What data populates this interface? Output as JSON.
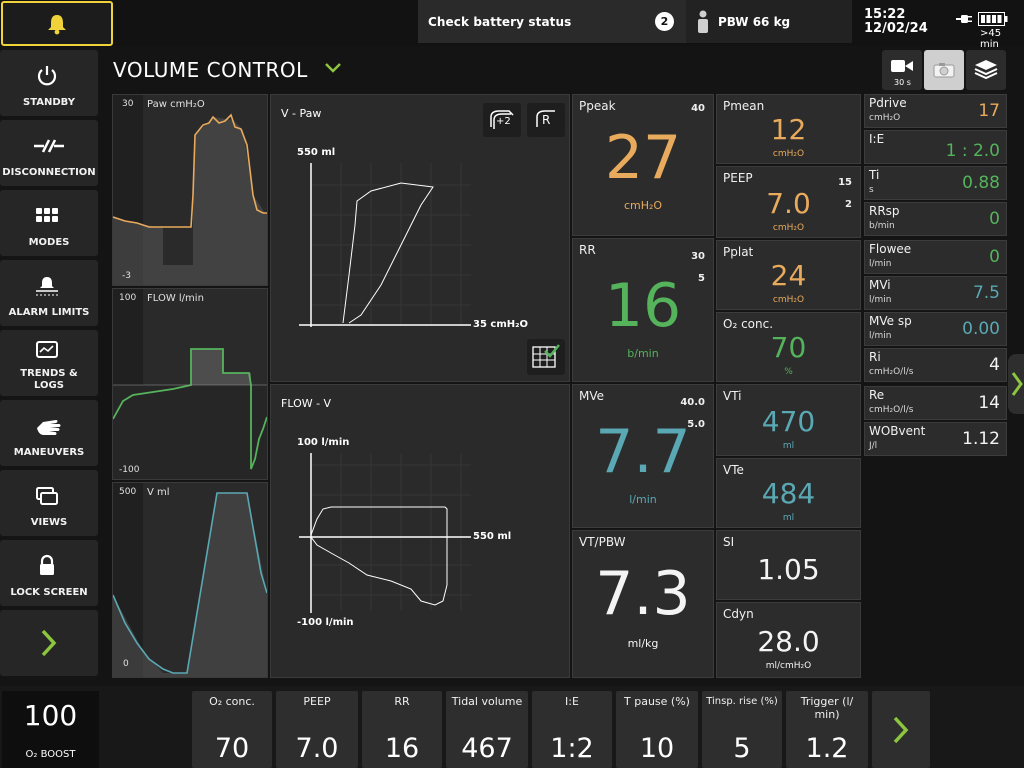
{
  "colors": {
    "alarm": "#f0d23a",
    "orange": "#e8aa5c",
    "green": "#55b35c",
    "teal": "#5aa8b4",
    "accent_green": "#8cc63f"
  },
  "topbar": {
    "alarm_message": "Check battery status",
    "alarm_count": "2",
    "pbw": "PBW 66 kg",
    "time": "15:22",
    "date": "12/02/24",
    "battery_remaining": ">45 min"
  },
  "nav": {
    "standby": "STANDBY",
    "disconnection": "DISCONNECTION",
    "modes": "MODES",
    "alarm_limits": "ALARM LIMITS",
    "trends_logs": "TRENDS & LOGS",
    "maneuvers": "MANEUVERS",
    "views": "VIEWS",
    "lock_screen": "LOCK SCREEN"
  },
  "mode": {
    "title": "VOLUME CONTROL"
  },
  "toolbar": {
    "record_label": "30 s"
  },
  "waves": {
    "paw": {
      "label": "Paw cmH₂O",
      "max": "30",
      "min": "-3"
    },
    "flow": {
      "label": "FLOW l/min",
      "max": "100",
      "min": "-100"
    },
    "vol": {
      "label": "V ml",
      "max": "500",
      "min": "0"
    }
  },
  "loops": {
    "vpaw": {
      "title": "V - Paw",
      "y_label": "550 ml",
      "x_label": "35 cmH₂O",
      "btn1": "+2",
      "btn2": "R"
    },
    "flowv": {
      "title": "FLOW - V",
      "y_top": "100 l/min",
      "y_bottom": "-100 l/min",
      "x_label": "550 ml"
    }
  },
  "tiles": {
    "ppeak": {
      "name": "Ppeak",
      "limit_hi": "40",
      "value": "27",
      "unit": "cmH₂O"
    },
    "rr": {
      "name": "RR",
      "limit_hi": "30",
      "limit_lo": "5",
      "value": "16",
      "unit": "b/min"
    },
    "mve": {
      "name": "MVe",
      "limit_hi": "40.0",
      "limit_lo": "5.0",
      "value": "7.7",
      "unit": "l/min"
    },
    "vtpbw": {
      "name": "VT/PBW",
      "value": "7.3",
      "unit": "ml/kg"
    },
    "pmean": {
      "name": "Pmean",
      "value": "12",
      "unit": "cmH₂O"
    },
    "peep": {
      "name": "PEEP",
      "limit_hi": "15",
      "limit_lo": "2",
      "value": "7.0",
      "unit": "cmH₂O"
    },
    "pplat": {
      "name": "Pplat",
      "value": "24",
      "unit": "cmH₂O"
    },
    "o2": {
      "name": "O₂ conc.",
      "value": "70",
      "unit": "%"
    },
    "vti": {
      "name": "VTi",
      "value": "470",
      "unit": "ml"
    },
    "vte": {
      "name": "VTe",
      "value": "484",
      "unit": "ml"
    },
    "si": {
      "name": "SI",
      "value": "1.05"
    },
    "cdyn": {
      "name": "Cdyn",
      "value": "28.0",
      "unit": "ml/cmH₂O"
    }
  },
  "small": [
    {
      "name": "Pdrive",
      "sub": "cmH₂O",
      "value": "17"
    },
    {
      "name": "I:E",
      "sub": "",
      "value": "1 : 2.0"
    },
    {
      "name": "Ti",
      "sub": "s",
      "value": "0.88"
    },
    {
      "name": "RRsp",
      "sub": "b/min",
      "value": "0"
    },
    {
      "name": "Flowee",
      "sub": "l/min",
      "value": "0"
    },
    {
      "name": "MVi",
      "sub": "l/min",
      "value": "7.5"
    },
    {
      "name": "MVe sp",
      "sub": "l/min",
      "value": "0.00"
    },
    {
      "name": "Ri",
      "sub": "cmH₂O/l/s",
      "value": "4"
    },
    {
      "name": "Re",
      "sub": "cmH₂O/l/s",
      "value": "14"
    },
    {
      "name": "WOBvent",
      "sub": "J/l",
      "value": "1.12"
    }
  ],
  "bottom": {
    "o2boost": {
      "value": "100",
      "label": "O₂ BOOST"
    },
    "settings": [
      {
        "name": "O₂ conc.",
        "value": "70"
      },
      {
        "name": "PEEP",
        "value": "7.0"
      },
      {
        "name": "RR",
        "value": "16"
      },
      {
        "name": "Tidal volume",
        "value": "467"
      },
      {
        "name": "I:E",
        "value": "1:2"
      },
      {
        "name": "T pause (%)",
        "value": "10"
      },
      {
        "name": "Tinsp. rise (%)",
        "value": "5"
      },
      {
        "name": "Trigger (l/ min)",
        "value": "1.2"
      }
    ]
  }
}
